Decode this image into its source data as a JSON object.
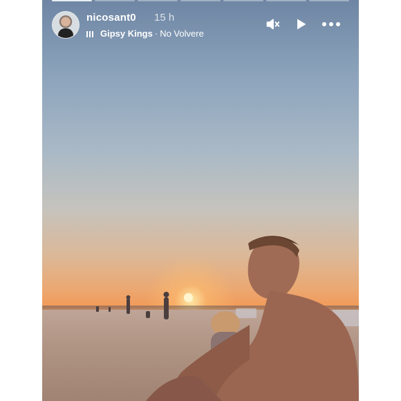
{
  "story": {
    "username": "nicosant0",
    "time_ago": "15 h",
    "music": {
      "artist": "Gipsy Kings",
      "separator": "·",
      "song": "No Volvere"
    },
    "progress_segments_total": 7,
    "progress_segments_done": 0
  },
  "icons": {
    "avatar": "avatar",
    "music": "music-bars-icon",
    "mute": "speaker-muted-icon",
    "play": "play-icon",
    "more": "more-horizontal-icon"
  },
  "colors": {
    "text": "#ffffff",
    "sky_top": "#6e86a4",
    "sunset": "#f19c5c"
  }
}
